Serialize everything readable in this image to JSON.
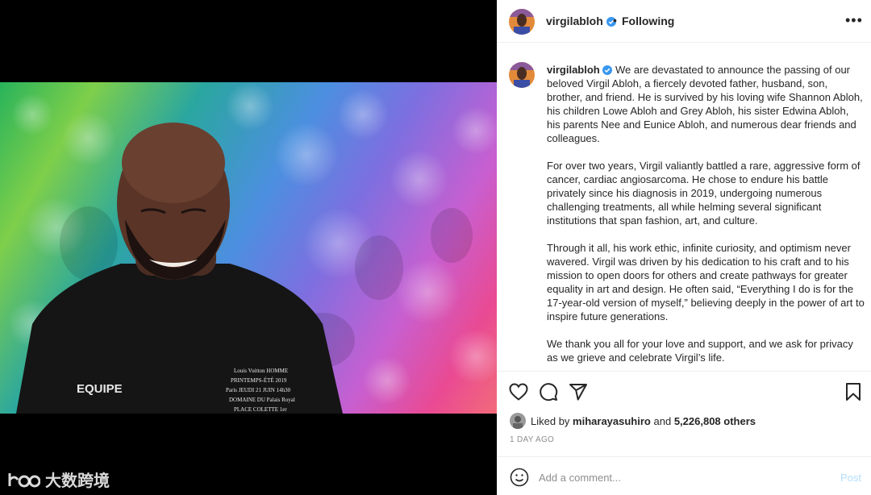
{
  "post": {
    "username": "virgilabloh",
    "follow_separator": "•",
    "follow_status": "Following",
    "more_label": "•••"
  },
  "caption": {
    "username": "virgilabloh",
    "paragraphs": [
      "We are devastated to announce the passing of our beloved Virgil Abloh, a fiercely devoted father, husband, son, brother, and friend. He is survived by his loving wife Shannon Abloh, his children Lowe Abloh and Grey Abloh, his sister Edwina Abloh, his parents Nee and Eunice Abloh, and numerous dear friends and colleagues.",
      "For over two years, Virgil valiantly battled a rare, aggressive form of cancer, cardiac angiosarcoma. He chose to endure his battle privately since his diagnosis in 2019, undergoing numerous challenging treatments, all while helming several significant institutions that span fashion, art, and culture.",
      "Through it all, his work ethic, infinite curiosity, and optimism never wavered. Virgil was driven by his dedication to his craft and to his mission to open doors for others and create pathways for greater equality in art and design. He often said, “Everything I do is for the 17-year-old version of myself,” believing deeply in the power of art to inspire future generations.",
      "We thank you all for your love and support, and we ask for privacy as we grieve and celebrate Virgil’s life."
    ]
  },
  "likes": {
    "prefix": "Liked by",
    "user": "miharayasuhiro",
    "conjunction": "and",
    "others": "5,226,808 others"
  },
  "timestamp": "1 DAY AGO",
  "comment": {
    "placeholder": "Add a comment...",
    "post_label": "Post"
  },
  "media": {
    "shirt_text": "EQUIPE",
    "print_lines": [
      "Louis Vuitton HOMME",
      "PRINTEMPS-ÉTÉ 2019",
      "Paris JEUDI 21 JUIN 14h30",
      "DOMAINE DU Palais Royal",
      "PLACE COLETTE 1er"
    ]
  },
  "watermark": {
    "text": "大数跨境"
  },
  "colors": {
    "link_post": "#b2dffc",
    "verified": "#3897f0",
    "muted": "#8e8e8e"
  },
  "icons": [
    "like-icon",
    "comment-icon",
    "share-icon",
    "save-icon",
    "emoji-icon",
    "verified-icon",
    "more-icon"
  ]
}
